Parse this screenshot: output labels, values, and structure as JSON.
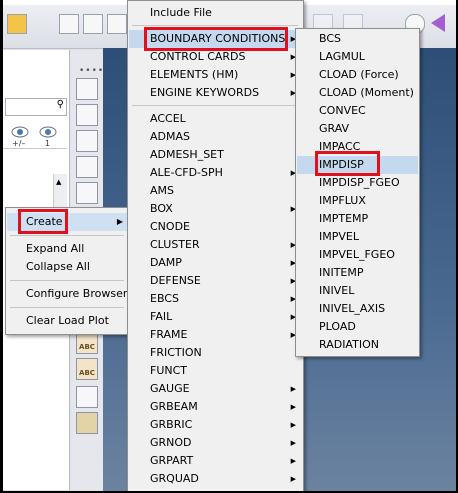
{
  "menu_main": {
    "header": "Include File",
    "items": [
      {
        "label": "BOUNDARY CONDITIONS",
        "submenu": true
      },
      {
        "label": "CONTROL CARDS",
        "submenu": true
      },
      {
        "label": "ELEMENTS (HM)",
        "submenu": true
      },
      {
        "label": "ENGINE KEYWORDS",
        "submenu": true
      },
      {
        "label": "ACCEL",
        "submenu": false
      },
      {
        "label": "ADMAS",
        "submenu": false
      },
      {
        "label": "ADMESH_SET",
        "submenu": false
      },
      {
        "label": "ALE-CFD-SPH",
        "submenu": true
      },
      {
        "label": "AMS",
        "submenu": false
      },
      {
        "label": "BOX",
        "submenu": true
      },
      {
        "label": "CNODE",
        "submenu": false
      },
      {
        "label": "CLUSTER",
        "submenu": true
      },
      {
        "label": "DAMP",
        "submenu": true
      },
      {
        "label": "DEFENSE",
        "submenu": true
      },
      {
        "label": "EBCS",
        "submenu": true
      },
      {
        "label": "FAIL",
        "submenu": true
      },
      {
        "label": "FRAME",
        "submenu": true
      },
      {
        "label": "FRICTION",
        "submenu": false
      },
      {
        "label": "FUNCT",
        "submenu": false
      },
      {
        "label": "GAUGE",
        "submenu": true
      },
      {
        "label": "GRBEAM",
        "submenu": true
      },
      {
        "label": "GRBRIC",
        "submenu": true
      },
      {
        "label": "GRNOD",
        "submenu": true
      },
      {
        "label": "GRPART",
        "submenu": true
      },
      {
        "label": "GRQUAD",
        "submenu": true
      }
    ]
  },
  "menu_bc": {
    "items": [
      "BCS",
      "LAGMUL",
      "CLOAD (Force)",
      "CLOAD (Moment)",
      "CONVEC",
      "GRAV",
      "IMPACC",
      "IMPDISP",
      "IMPDISP_FGEO",
      "IMPFLUX",
      "IMPTEMP",
      "IMPVEL",
      "IMPVEL_FGEO",
      "INITEMP",
      "INIVEL",
      "INIVEL_AXIS",
      "PLOAD",
      "RADIATION"
    ],
    "selected": "IMPDISP"
  },
  "context_menu": {
    "create": "Create",
    "expand_all": "Expand All",
    "collapse_all": "Collapse All",
    "configure_browser": "Configure Browser",
    "clear_load_plot": "Clear Load Plot"
  },
  "left_panel": {
    "eye_label_1": "+/–",
    "eye_label_2": "1"
  },
  "colors": {
    "highlight": "#c4d8ee",
    "annotation_red": "#e0101c",
    "graphics_bg": "#3a5a82"
  }
}
